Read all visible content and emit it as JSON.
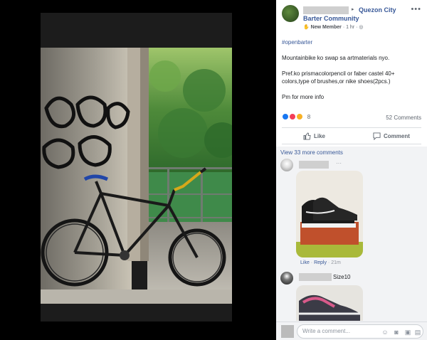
{
  "post": {
    "group_line1": "Quezon City",
    "group_line2": "Barter Community",
    "author_badge": "New Member",
    "time": "1 hr",
    "arrow": "▸",
    "hashtag": "#openbarter",
    "line1": "Mountainbike ko swap sa artmaterials nyo.",
    "line2": "Pref.ko prismacolorpencil or faber castel 40+ colors,type of brushes,or nike shoes(2pcs.)",
    "line3": "Pm for more info",
    "reaction_count": "8",
    "comment_count": "52 Comments",
    "like_label": "Like",
    "comment_label": "Comment",
    "more_icon": "•••"
  },
  "comments": {
    "view_more": "View 33 more comments",
    "c1_dots": "···",
    "c1_like": "Like",
    "c1_sep": " · ",
    "c1_reply": "Reply",
    "c1_time": " · 21m",
    "c2_text": "Size10"
  },
  "composer": {
    "placeholder": "Write a comment..."
  },
  "icons": {
    "more": "more-icon",
    "globe": "globe-icon",
    "member": "member-icon"
  }
}
